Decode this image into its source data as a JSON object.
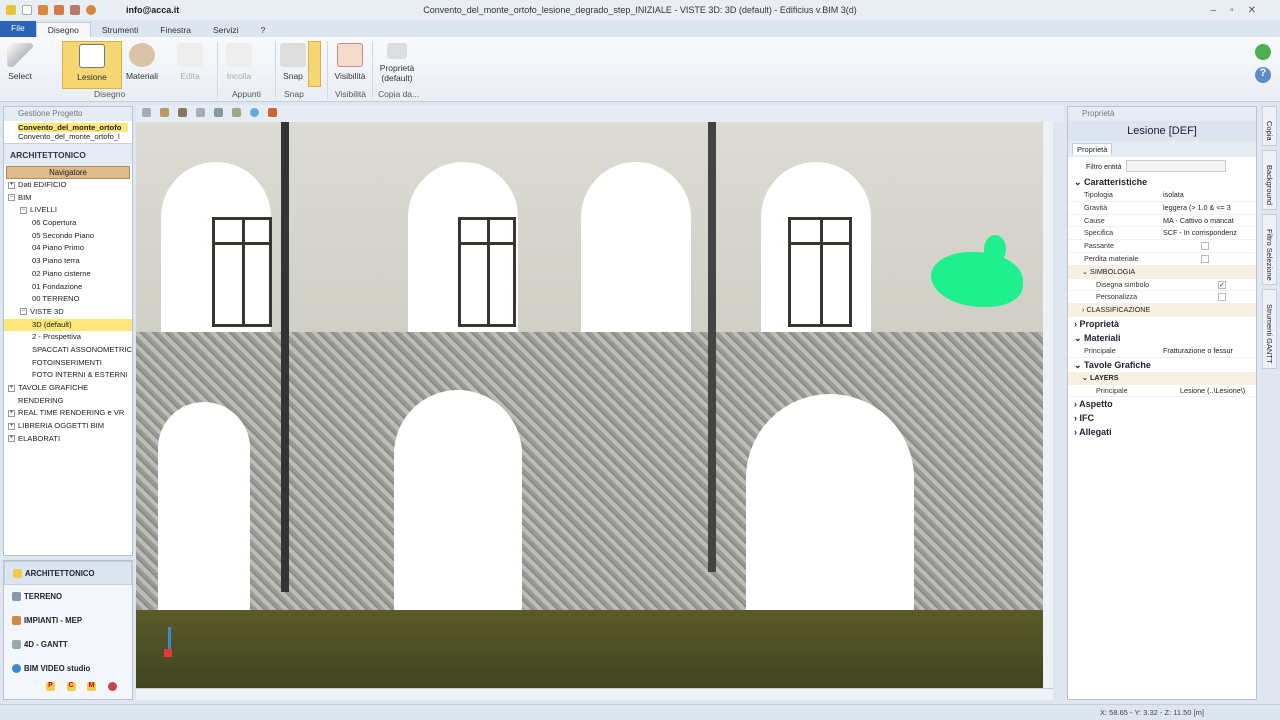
{
  "window": {
    "title": "Convento_del_monte_ortofo_lesione_degrado_step_INIZIALE - VISTE 3D: 3D (default) - Edificius v.BIM 3(d)",
    "user": "info@acca.it"
  },
  "menu_tabs": [
    "File",
    "Disegno",
    "Strumenti",
    "Finestra",
    "Servizi",
    "?"
  ],
  "ribbon": {
    "buttons": {
      "select": "Select",
      "lesione": "Lesione",
      "materiali": "Materiali",
      "edita": "Edita",
      "incolla": "Incolla",
      "snap": "Snap",
      "visibilita": "Visibilità",
      "proprieta": "Proprietà (default)"
    },
    "groups": {
      "disegno": "Disegno",
      "appunti": "Appunti",
      "snap": "Snap",
      "visibilita": "Visibilità",
      "copia": "Copia da..."
    }
  },
  "project_panel": {
    "title": "Gestione Progetto",
    "files": [
      "Convento_del_monte_ortofo",
      "Convento_del_monte_ortofo_l"
    ],
    "section": "ARCHITETTONICO",
    "navigator": "Navigatore",
    "tree": [
      "Dati EDIFICIO",
      "BIM",
      "LIVELLI",
      "06 Copertura",
      "05 Secondo Piano",
      "04 Piano Primo",
      "03 Piano terra",
      "02 Piano cisterne",
      "01 Fondazione",
      "00 TERRENO",
      "VISTE 3D",
      "3D (default)",
      "2 - Prospettiva",
      "SPACCATI ASSONOMETRICI",
      "FOTOINSERIMENTI",
      "FOTO INTERNI & ESTERNI",
      "TAVOLE GRAFICHE",
      "RENDERING",
      "REAL TIME RENDERING e VR",
      "LIBRERIA OGGETTI BIM",
      "ELABORATI"
    ]
  },
  "modules": [
    "ARCHITETTONICO",
    "TERRENO",
    "IMPIANTI - MEP",
    "4D - GANTT",
    "BIM VIDEO studio"
  ],
  "module_badges": [
    "P",
    "C",
    "M"
  ],
  "properties": {
    "panel_title": "Proprietà",
    "header": "Lesione [DEF]",
    "tab": "Proprietà",
    "filter_label": "Filtro entità",
    "sections": {
      "caratteristiche": "Caratteristiche",
      "proprieta": "Proprietà",
      "materiali": "Materiali",
      "tavole": "Tavole Grafiche",
      "aspetto": "Aspetto",
      "ifc": "IFC",
      "allegati": "Allegati"
    },
    "rows": {
      "tipologia": [
        "Tipologia",
        "isolata"
      ],
      "gravita": [
        "Gravità",
        "leggera (> 1.0 & <= 3"
      ],
      "cause": [
        "Cause",
        "MA - Cattivo o mancat"
      ],
      "specifica": [
        "Specifica",
        "SCF - In corrispondenz"
      ],
      "passante": [
        "Passante",
        ""
      ],
      "perdita": [
        "Perdita materiale",
        ""
      ],
      "disegna": [
        "Disegna simbolo",
        "✓"
      ],
      "personalizza": [
        "Personalizza",
        ""
      ],
      "mat_principale": [
        "Principale",
        "Fratturazione o fessur"
      ],
      "layer_principale": [
        "Principale",
        "Lesione   (..\\Lesione\\)"
      ]
    },
    "subs": {
      "simbologia": "SIMBOLOGIA",
      "classificazione": "CLASSIFICAZIONE",
      "layers": "LAYERS"
    }
  },
  "side_tabs": [
    "Copia",
    "Background",
    "Filtro Selezione",
    "Strumenti GANTT"
  ],
  "status": {
    "coords": "X: 58.65 - Y: 3.32 - Z: 11.50 [m]"
  }
}
